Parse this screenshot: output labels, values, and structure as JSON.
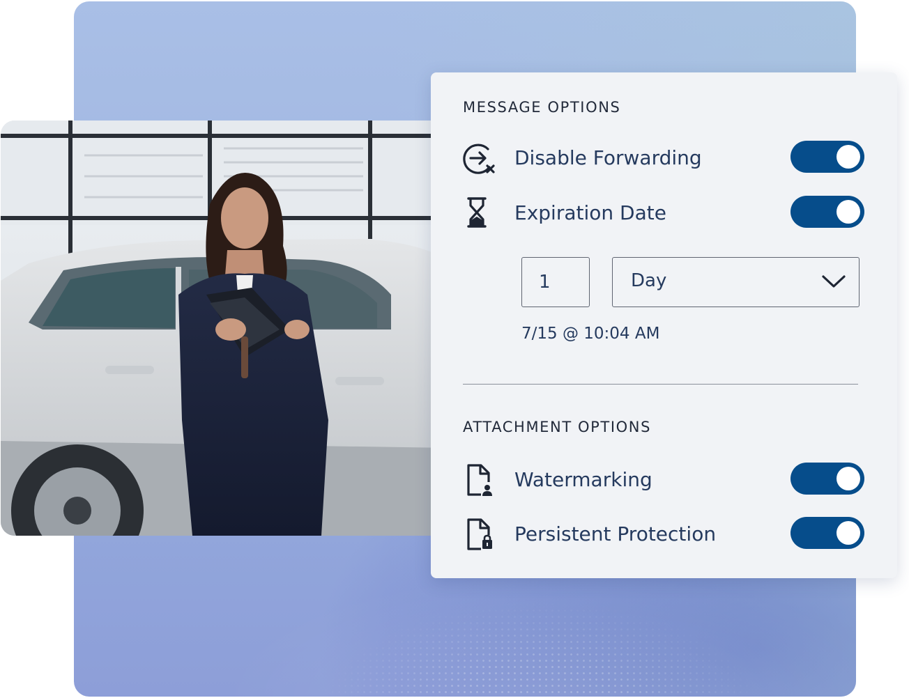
{
  "message_options": {
    "title": "MESSAGE OPTIONS",
    "disable_forwarding": {
      "label": "Disable Forwarding",
      "icon": "forward-blocked-icon",
      "enabled": true
    },
    "expiration_date": {
      "label": "Expiration Date",
      "icon": "hourglass-icon",
      "enabled": true,
      "amount": "1",
      "unit": "Day",
      "expires_text": "7/15 @ 10:04 AM"
    }
  },
  "attachment_options": {
    "title": "ATTACHMENT OPTIONS",
    "watermarking": {
      "label": "Watermarking",
      "icon": "document-user-icon",
      "enabled": true
    },
    "persistent_protection": {
      "label": "Persistent Protection",
      "icon": "document-lock-icon",
      "enabled": true
    }
  },
  "colors": {
    "toggle_on": "#064d8b",
    "card_background": "#f1f3f6",
    "text": "#253a5e"
  }
}
